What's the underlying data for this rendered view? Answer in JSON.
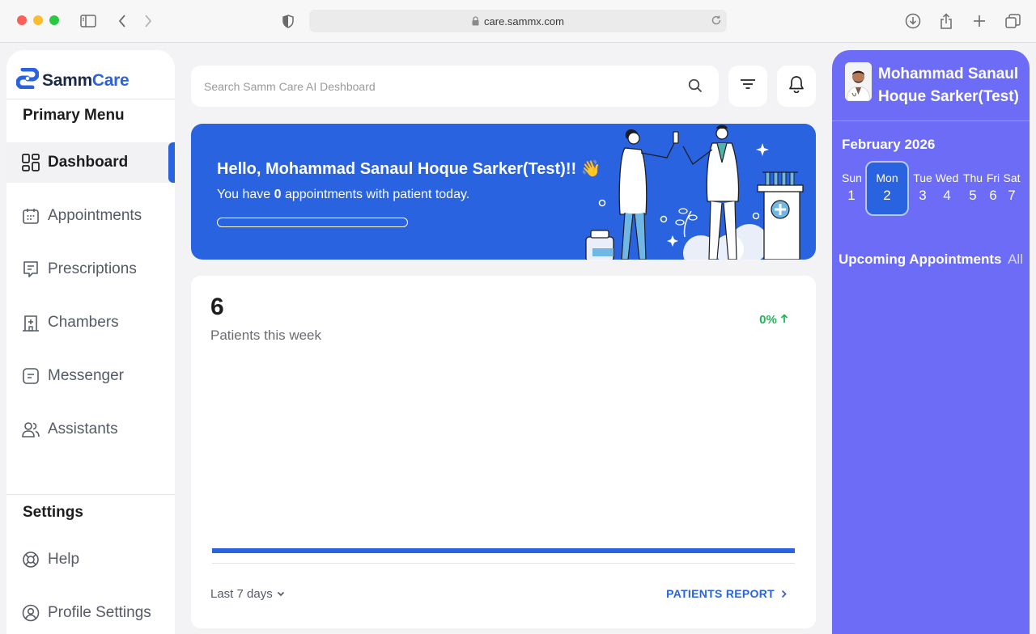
{
  "browser": {
    "url": "care.sammx.com"
  },
  "sidebar": {
    "logo_part1": "Samm",
    "logo_part2": "Care",
    "primary_title": "Primary Menu",
    "items": [
      {
        "label": "Dashboard",
        "icon": "dashboard-icon",
        "active": true
      },
      {
        "label": "Appointments",
        "icon": "calendar-icon"
      },
      {
        "label": "Prescriptions",
        "icon": "prescription-icon"
      },
      {
        "label": "Chambers",
        "icon": "hospital-icon"
      },
      {
        "label": "Messenger",
        "icon": "message-icon"
      },
      {
        "label": "Assistants",
        "icon": "users-icon"
      }
    ],
    "settings_title": "Settings",
    "settings_items": [
      {
        "label": "Help",
        "icon": "lifebuoy-icon"
      },
      {
        "label": "Profile Settings",
        "icon": "profile-icon"
      }
    ]
  },
  "search": {
    "placeholder": "Search Samm Care AI Deshboard"
  },
  "banner": {
    "greeting": "Hello, Mohammad Sanaul Hoque Sarker(Test)!! 👋",
    "sub_prefix": "You have ",
    "appointments_count": "0",
    "sub_suffix": " appointments with patient today.",
    "progress": 0
  },
  "stats": {
    "value": "6",
    "label": "Patients this week",
    "change": "0%",
    "range": "Last 7 days",
    "report_link": "PATIENTS REPORT"
  },
  "profile": {
    "name": "Mohammad Sanaul Hoque Sarker(Test)"
  },
  "calendar": {
    "month": "February 2026",
    "days": [
      {
        "name": "Sun",
        "num": "1"
      },
      {
        "name": "Mon",
        "num": "2",
        "selected": true
      },
      {
        "name": "Tue",
        "num": "3"
      },
      {
        "name": "Wed",
        "num": "4"
      },
      {
        "name": "Thu",
        "num": "5"
      },
      {
        "name": "Fri",
        "num": "6"
      },
      {
        "name": "Sat",
        "num": "7"
      }
    ]
  },
  "upcoming": {
    "title": "Upcoming Appointments",
    "all_label": "All"
  },
  "colors": {
    "primary": "#2a63e0",
    "panel": "#6c6cf6",
    "positive": "#22b45a"
  }
}
